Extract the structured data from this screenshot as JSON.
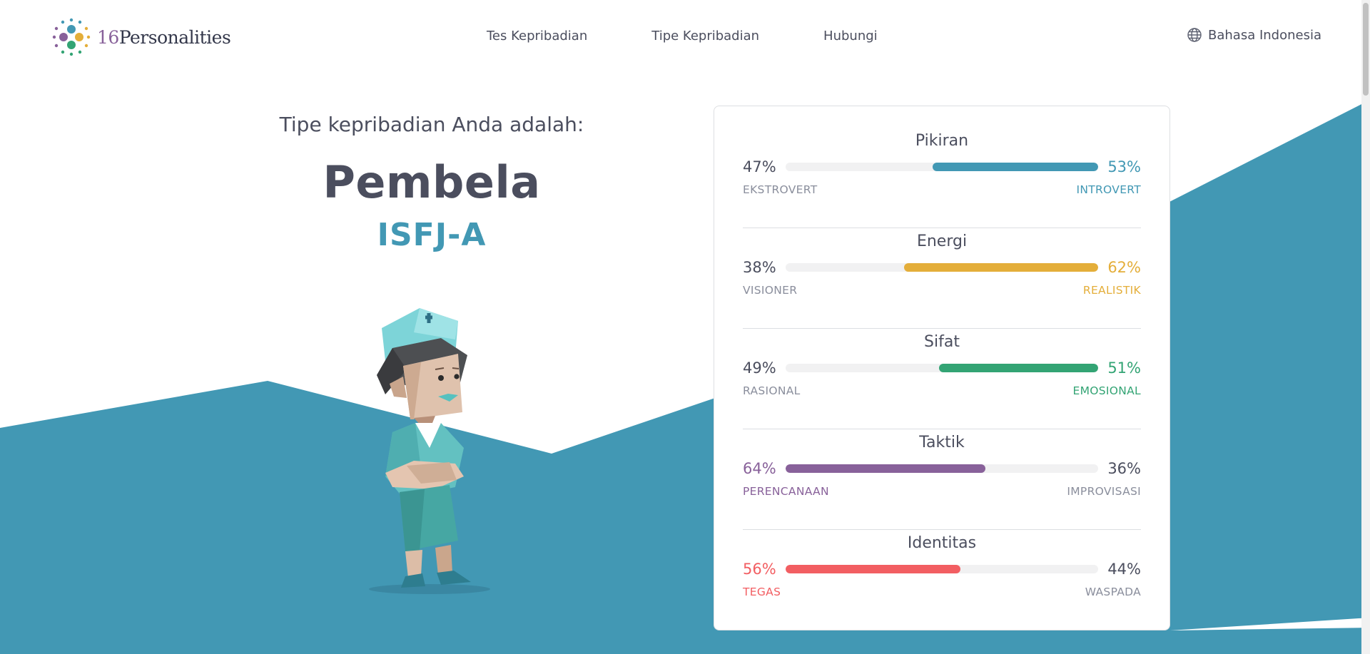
{
  "header": {
    "logo_number": "16",
    "logo_word": "Personalities",
    "nav": [
      "Tes Kepribadian",
      "Tipe Kepribadian",
      "Hubungi"
    ],
    "language": "Bahasa Indonesia",
    "language_icon": "globe-icon"
  },
  "result": {
    "intro": "Tipe kepribadian Anda adalah:",
    "type_name": "Pembela",
    "type_code": "ISFJ-A"
  },
  "traits": [
    {
      "title": "Pikiran",
      "left_pct": "47%",
      "right_pct": "53%",
      "left_label": "EKSTROVERT",
      "right_label": "INTROVERT",
      "dominant": "right",
      "fill_fraction": 0.53,
      "color": "#4298b4"
    },
    {
      "title": "Energi",
      "left_pct": "38%",
      "right_pct": "62%",
      "left_label": "VISIONER",
      "right_label": "REALISTIK",
      "dominant": "right",
      "fill_fraction": 0.62,
      "color": "#e4ae3a"
    },
    {
      "title": "Sifat",
      "left_pct": "49%",
      "right_pct": "51%",
      "left_label": "RASIONAL",
      "right_label": "EMOSIONAL",
      "dominant": "right",
      "fill_fraction": 0.51,
      "color": "#33a474"
    },
    {
      "title": "Taktik",
      "left_pct": "64%",
      "right_pct": "36%",
      "left_label": "PERENCANAAN",
      "right_label": "IMPROVISASI",
      "dominant": "left",
      "fill_fraction": 0.64,
      "color": "#88619a"
    },
    {
      "title": "Identitas",
      "left_pct": "56%",
      "right_pct": "44%",
      "left_label": "TEGAS",
      "right_label": "WASPADA",
      "dominant": "left",
      "fill_fraction": 0.56,
      "color": "#f25e62"
    }
  ],
  "colors": {
    "background_wave": "#4298b4",
    "text_dark": "#4b4e5e",
    "text_muted": "#8a8e9c"
  }
}
